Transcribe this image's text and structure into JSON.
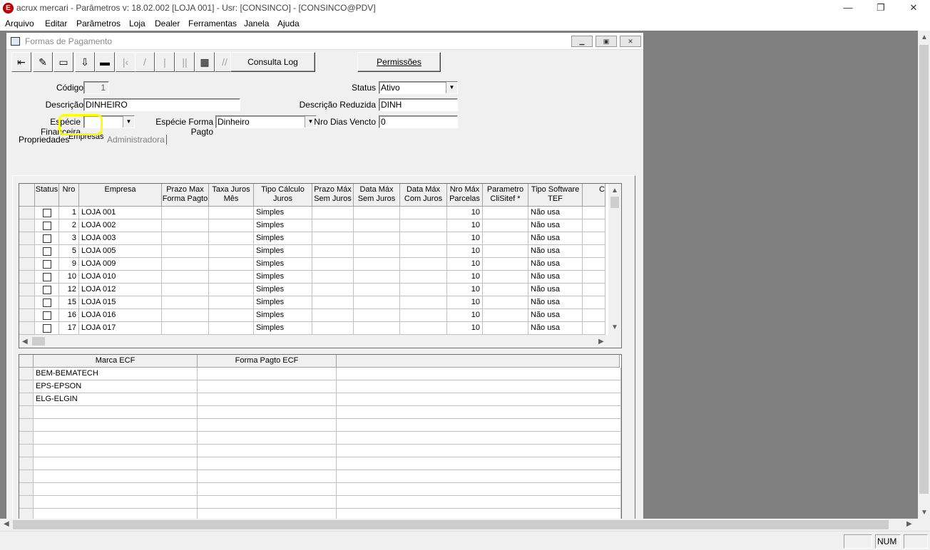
{
  "app": {
    "title": "acrux mercari - Parâmetros  v: 18.02.002   [LOJA 001] - Usr: [CONSINCO] - [CONSINCO@PDV]",
    "icon_letter": "E"
  },
  "window_controls": {
    "minimize": "—",
    "restore": "❐",
    "close": "✕"
  },
  "menu": [
    "Arquivo",
    "Editar",
    "Parâmetros",
    "Loja",
    "Dealer",
    "Ferramentas",
    "Janela",
    "Ajuda"
  ],
  "child": {
    "title": "Formas de Pagamento",
    "controls": {
      "minimize": "▁",
      "restore": "▣",
      "close": "✕"
    }
  },
  "toolbar": {
    "icons": [
      "exit-icon",
      "eraser-icon",
      "new-record-icon",
      "save-icon",
      "delete-icon",
      "first-record-icon",
      "prev-record-icon",
      "next-record-icon",
      "last-record-icon",
      "grid-view-icon",
      "print-icon"
    ],
    "glyphs": [
      "⇤",
      "✎",
      "▭",
      "⇩",
      "▬",
      "|‹",
      "/",
      "|",
      "||",
      "▦",
      "//"
    ],
    "consulta_log": "Consulta Log",
    "permissoes": "Permissões"
  },
  "form": {
    "codigo": {
      "label": "Código",
      "value": "1"
    },
    "status": {
      "label": "Status",
      "value": "Ativo"
    },
    "descricao": {
      "label": "Descrição",
      "value": "DINHEIRO"
    },
    "descricao_reduzida": {
      "label": "Descrição Reduzida",
      "value": "DINH"
    },
    "especie_financeira": {
      "label": "Espécie Financeira",
      "value": ""
    },
    "especie_forma_pagto": {
      "label": "Espécie Forma Pagto",
      "value": "Dinheiro"
    },
    "nro_dias_vencto": {
      "label": "Nro Dias Vencto",
      "value": "0"
    }
  },
  "tabs": [
    "Propriedades",
    "Empresas",
    "Administradora"
  ],
  "active_tab": "Empresas",
  "highlight_color": "#ffff00",
  "empresas_grid": {
    "columns": [
      {
        "l1": "Status",
        "l2": ""
      },
      {
        "l1": "Nro",
        "l2": ""
      },
      {
        "l1": "Empresa",
        "l2": ""
      },
      {
        "l1": "Prazo Max",
        "l2": "Forma Pagto"
      },
      {
        "l1": "Taxa Juros",
        "l2": "Mês"
      },
      {
        "l1": "Tipo Cálculo",
        "l2": "Juros"
      },
      {
        "l1": "Prazo Máx",
        "l2": "Sem Juros"
      },
      {
        "l1": "Data Máx",
        "l2": "Sem Juros"
      },
      {
        "l1": "Data Máx",
        "l2": "Com Juros"
      },
      {
        "l1": "Nro Máx",
        "l2": "Parcelas"
      },
      {
        "l1": "Parametro",
        "l2": "CliSitef *"
      },
      {
        "l1": "Tipo Software",
        "l2": "TEF"
      },
      {
        "l1": "",
        "l2": "C"
      }
    ],
    "rows": [
      {
        "nro": "1",
        "empresa": "LOJA 001",
        "tipo_calculo": "Simples",
        "parcelas": "10",
        "tef": "Não usa"
      },
      {
        "nro": "2",
        "empresa": "LOJA 002",
        "tipo_calculo": "Simples",
        "parcelas": "10",
        "tef": "Não usa"
      },
      {
        "nro": "3",
        "empresa": "LOJA 003",
        "tipo_calculo": "Simples",
        "parcelas": "10",
        "tef": "Não usa"
      },
      {
        "nro": "5",
        "empresa": "LOJA 005",
        "tipo_calculo": "Simples",
        "parcelas": "10",
        "tef": "Não usa"
      },
      {
        "nro": "9",
        "empresa": "LOJA 009",
        "tipo_calculo": "Simples",
        "parcelas": "10",
        "tef": "Não usa"
      },
      {
        "nro": "10",
        "empresa": "LOJA 010",
        "tipo_calculo": "Simples",
        "parcelas": "10",
        "tef": "Não usa"
      },
      {
        "nro": "12",
        "empresa": "LOJA 012",
        "tipo_calculo": "Simples",
        "parcelas": "10",
        "tef": "Não usa"
      },
      {
        "nro": "15",
        "empresa": "LOJA 015",
        "tipo_calculo": "Simples",
        "parcelas": "10",
        "tef": "Não usa"
      },
      {
        "nro": "16",
        "empresa": "LOJA 016",
        "tipo_calculo": "Simples",
        "parcelas": "10",
        "tef": "Não usa"
      },
      {
        "nro": "17",
        "empresa": "LOJA 017",
        "tipo_calculo": "Simples",
        "parcelas": "10",
        "tef": "Não usa"
      }
    ]
  },
  "ecf_grid": {
    "columns": [
      "Marca ECF",
      "Forma Pagto ECF"
    ],
    "rows": [
      "BEM-BEMATECH",
      "EPS-EPSON",
      "ELG-ELGIN"
    ]
  },
  "statusbar": {
    "num": "NUM"
  }
}
